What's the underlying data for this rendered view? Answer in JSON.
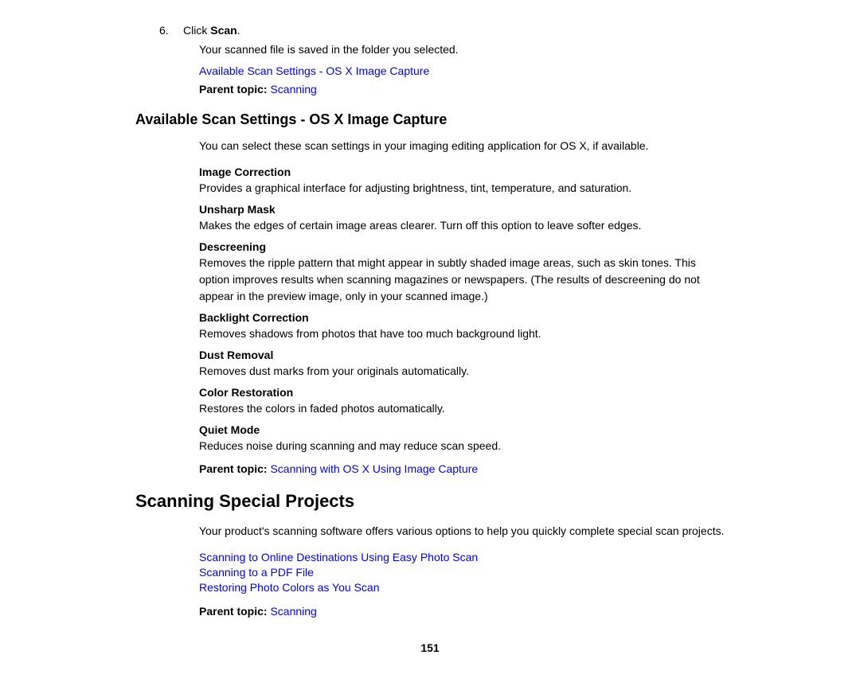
{
  "top_section": {
    "numbered_step": {
      "number": "6.",
      "text_before": "Click ",
      "bold_word": "Scan",
      "text_after": "."
    },
    "indented_note": "Your scanned file is saved in the folder you selected.",
    "link1": "Available Scan Settings - OS X Image Capture",
    "parent_topic_label": "Parent topic:",
    "parent_topic_link": "Scanning"
  },
  "available_scan_settings": {
    "heading": "Available Scan Settings - OS X Image Capture",
    "description": "You can select these scan settings in your imaging editing application for OS X, if available.",
    "terms": [
      {
        "title": "Image Correction",
        "description": "Provides a graphical interface for adjusting brightness, tint, temperature, and saturation."
      },
      {
        "title": "Unsharp Mask",
        "description": "Makes the edges of certain image areas clearer. Turn off this option to leave softer edges."
      },
      {
        "title": "Descreening",
        "description": "Removes the ripple pattern that might appear in subtly shaded image areas, such as skin tones. This option improves results when scanning magazines or newspapers. (The results of descreening do not appear in the preview image, only in your scanned image.)"
      },
      {
        "title": "Backlight Correction",
        "description": "Removes shadows from photos that have too much background light."
      },
      {
        "title": "Dust Removal",
        "description": "Removes dust marks from your originals automatically."
      },
      {
        "title": "Color Restoration",
        "description": "Restores the colors in faded photos automatically."
      },
      {
        "title": "Quiet Mode",
        "description": "Reduces noise during scanning and may reduce scan speed."
      }
    ],
    "parent_topic_label": "Parent topic:",
    "parent_topic_link": "Scanning with OS X Using Image Capture"
  },
  "scanning_special_projects": {
    "heading": "Scanning Special Projects",
    "description": "Your product's scanning software offers various options to help you quickly complete special scan projects.",
    "links": [
      "Scanning to Online Destinations Using Easy Photo Scan",
      "Scanning to a PDF File",
      "Restoring Photo Colors as You Scan"
    ],
    "parent_topic_label": "Parent topic:",
    "parent_topic_link": "Scanning"
  },
  "footer": {
    "page_number": "151"
  }
}
